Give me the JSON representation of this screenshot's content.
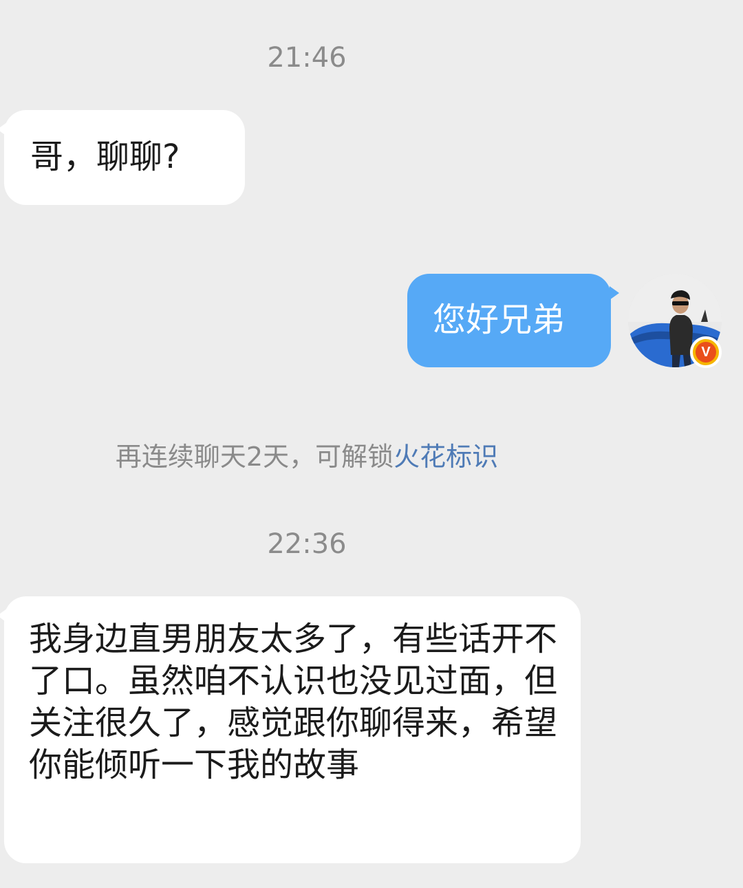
{
  "conversation": {
    "timestamps": [
      "21:46",
      "22:36"
    ],
    "messages": [
      {
        "sender": "contact",
        "text": "哥，聊聊?"
      },
      {
        "sender": "me",
        "text": "您好兄弟"
      },
      {
        "sender": "contact",
        "text": "我身边直男朋友太多了，有些话开不了口。虽然咱不认识也没见过面，但关注很久了，感觉跟你聊得来，希望你能倾听一下我的故事"
      }
    ],
    "system_notice": {
      "text": "再连续聊天2天，可解锁",
      "link_text": "火花标识"
    }
  },
  "avatar": {
    "badge_letter": "V",
    "icon": "verified-v-badge-icon"
  },
  "colors": {
    "background": "#ededed",
    "incoming_bubble": "#ffffff",
    "outgoing_bubble": "#56a9f6",
    "link": "#4f7bb6",
    "badge_outer": "#f6b500",
    "badge_inner": "#ea4f1b"
  }
}
